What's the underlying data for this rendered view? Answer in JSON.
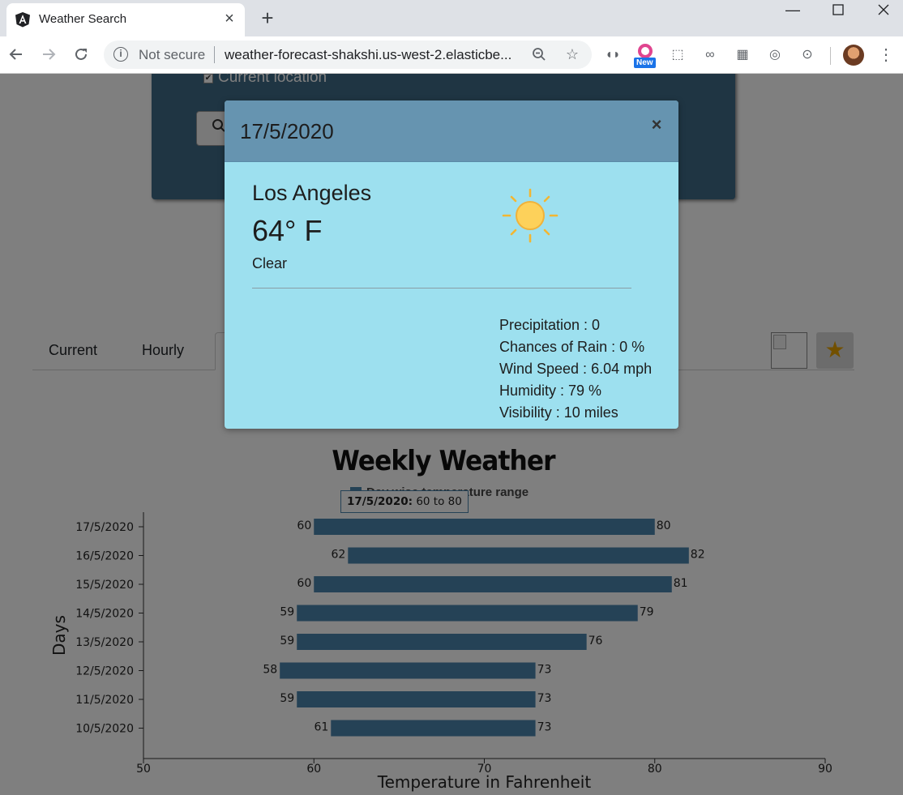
{
  "browser": {
    "tab_title": "Weather Search",
    "secure_label": "Not secure",
    "url": "weather-forecast-shakshi.us-west-2.elasticbe...",
    "extension_badge": "New"
  },
  "page": {
    "current_location_label": "Current location",
    "tabs": [
      {
        "label": "Current"
      },
      {
        "label": "Hourly"
      }
    ]
  },
  "modal": {
    "date": "17/5/2020",
    "city": "Los Angeles",
    "temperature": "64",
    "temp_unit": "° F",
    "condition": "Clear",
    "details": {
      "precipitation": "Precipitation : 0",
      "rain_chance": "Chances of Rain : 0 %",
      "wind": "Wind Speed : 6.04 mph",
      "humidity": "Humidity : 79 %",
      "visibility": "Visibility : 10 miles"
    },
    "close_glyph": "×"
  },
  "chart_data": {
    "type": "bar",
    "orientation": "horizontal",
    "title": "Weekly Weather",
    "legend": "Day wise temperature range",
    "xlabel": "Temperature in Fahrenheit",
    "ylabel": "Days",
    "xlim": [
      50,
      90
    ],
    "xticks": [
      50,
      60,
      70,
      80,
      90
    ],
    "categories": [
      "17/5/2020",
      "16/5/2020",
      "15/5/2020",
      "14/5/2020",
      "13/5/2020",
      "12/5/2020",
      "11/5/2020",
      "10/5/2020"
    ],
    "ranges": [
      [
        60,
        80
      ],
      [
        62,
        82
      ],
      [
        60,
        81
      ],
      [
        59,
        79
      ],
      [
        59,
        76
      ],
      [
        58,
        73
      ],
      [
        59,
        73
      ],
      [
        61,
        73
      ]
    ],
    "tooltip": {
      "label": "17/5/2020:",
      "value": "60 to 80"
    },
    "colors": {
      "bar": "#4a84ad"
    }
  }
}
